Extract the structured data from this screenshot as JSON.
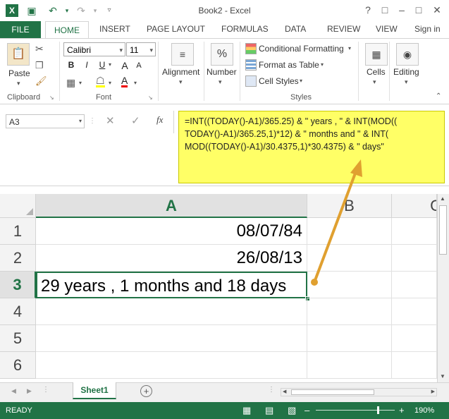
{
  "window": {
    "title": "Book2 - Excel"
  },
  "quick_access": [
    "excel-logo-icon",
    "save-icon",
    "undo-icon",
    "redo-icon",
    "customize-icon"
  ],
  "tabs": {
    "file": "FILE",
    "home": "HOME",
    "insert": "INSERT",
    "page_layout": "PAGE LAYOUT",
    "formulas": "FORMULAS",
    "data": "DATA",
    "review": "REVIEW",
    "view": "VIEW",
    "signin": "Sign in"
  },
  "ribbon": {
    "clipboard": {
      "paste": "Paste",
      "label": "Clipboard"
    },
    "font": {
      "name": "Calibri",
      "size": "11",
      "label": "Font",
      "bold": "B",
      "italic": "I",
      "underline": "U",
      "grow": "A",
      "shrink": "A"
    },
    "alignment": {
      "label": "Alignment"
    },
    "number": {
      "label": "Number",
      "icon_text": "%"
    },
    "styles": {
      "conditional": "Conditional Formatting",
      "table": "Format as Table",
      "cell_styles": "Cell Styles",
      "label": "Styles"
    },
    "cells": {
      "label": "Cells"
    },
    "editing": {
      "label": "Editing"
    }
  },
  "formula_bar": {
    "name_box": "A3",
    "fx": "fx",
    "formula": "=INT((TODAY()-A1)/365.25) & \" years , \" & INT(MOD((\nTODAY()-A1)/365.25,1)*12) & \" months and \" & INT(\nMOD((TODAY()-A1)/30.4375,1)*30.4375) & \" days\""
  },
  "grid": {
    "columns": [
      "A",
      "B",
      "C"
    ],
    "rows": [
      "1",
      "2",
      "3",
      "4",
      "5",
      "6"
    ],
    "cells": {
      "A1": "08/07/84",
      "A2": "26/08/13",
      "A3": "29 years , 1 months and 18 days"
    }
  },
  "sheet_tabs": {
    "active": "Sheet1"
  },
  "status": {
    "mode": "READY",
    "zoom": "190%"
  },
  "colors": {
    "accent": "#217346",
    "callout": "#ffff66",
    "arrow": "#e0a030"
  }
}
